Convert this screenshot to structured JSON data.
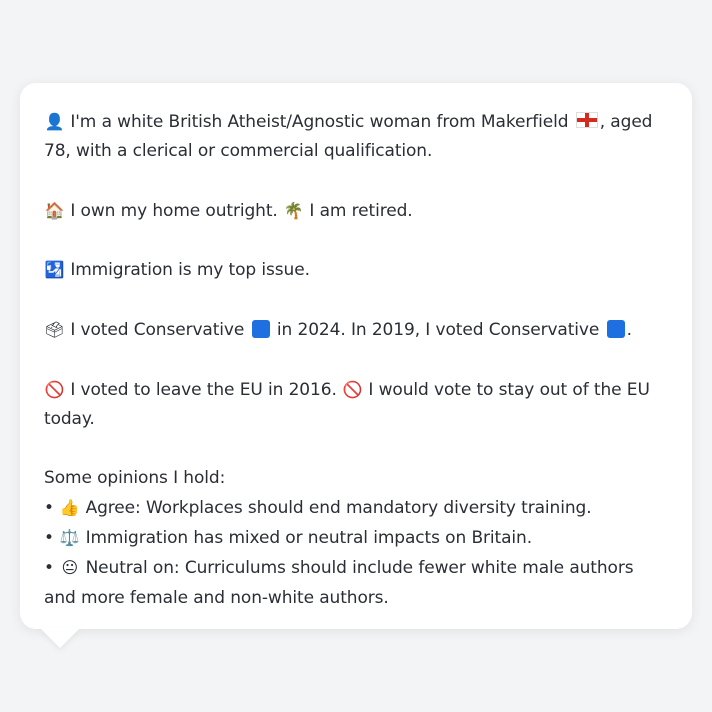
{
  "profile": {
    "intro": {
      "person_icon": "👤",
      "text1": "I'm a white British Atheist/Agnostic woman from Makerfield",
      "flag_icon": "england-flag",
      "text2": ", aged 78, with a clerical or commercial qualification."
    },
    "home": {
      "home_icon": "🏠",
      "text1": "I own my home outright.",
      "palm_icon": "🌴",
      "text2": "I am retired."
    },
    "issue": {
      "icon": "🛂",
      "text": "Immigration is my top issue."
    },
    "vote": {
      "icon": "🗳",
      "text1": "I voted Conservative",
      "text2": "in 2024. In 2019, I voted Conservative",
      "text3": ".",
      "party_color": "#1e6fe0"
    },
    "eu": {
      "icon1": "🚫",
      "text1": "I voted to leave the EU in 2016.",
      "icon2": "🚫",
      "text2": "I would vote to stay out of the EU today."
    },
    "opinions": {
      "heading": "Some opinions I hold:",
      "items": [
        {
          "bullet": "•",
          "icon": "👍",
          "text": "Agree: Workplaces should end mandatory diversity training."
        },
        {
          "bullet": "•",
          "icon": "⚖️",
          "text": "Immigration has mixed or neutral impacts on Britain."
        },
        {
          "bullet": "•",
          "icon": "😐",
          "text": "Neutral on: Curriculums should include fewer white male authors and more female and non-white authors."
        }
      ]
    }
  }
}
